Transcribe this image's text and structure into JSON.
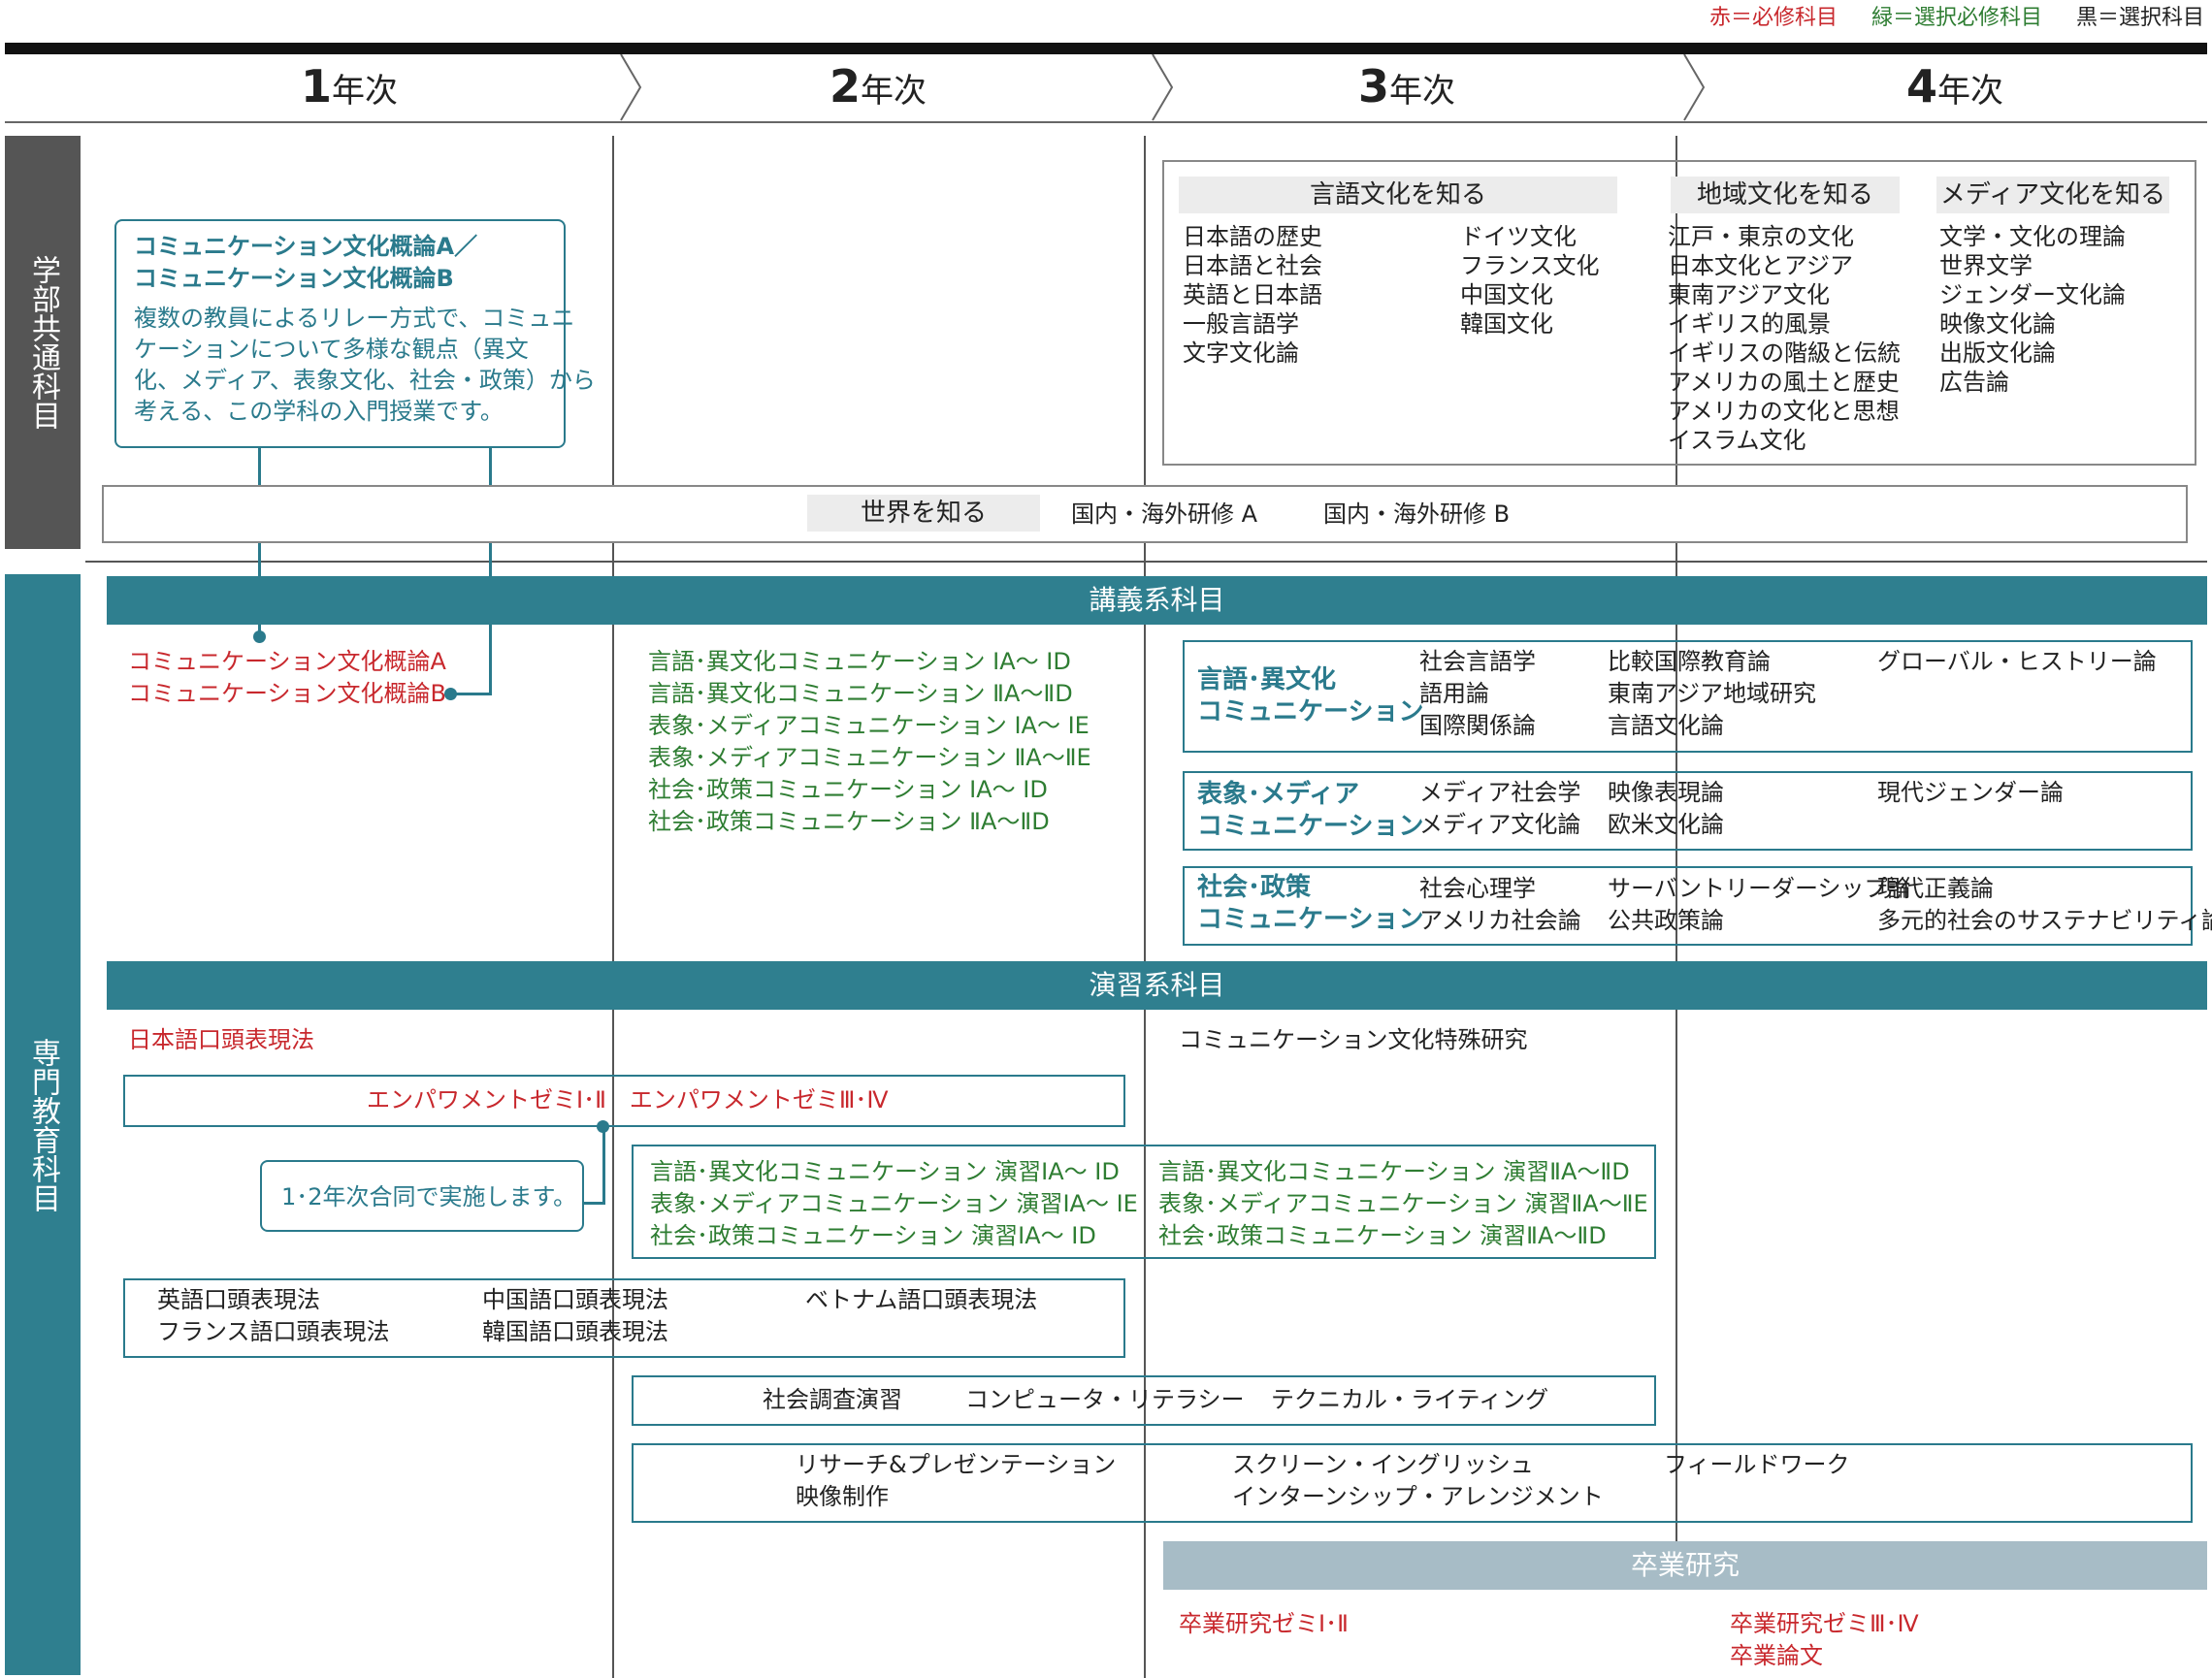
{
  "legend": {
    "red": "赤＝必修科目",
    "green": "緑＝選択必修科目",
    "black": "黒＝選択科目"
  },
  "years": [
    {
      "num": "1",
      "label": "年次"
    },
    {
      "num": "2",
      "label": "年次"
    },
    {
      "num": "3",
      "label": "年次"
    },
    {
      "num": "4",
      "label": "年次"
    }
  ],
  "sidebar": {
    "common": "学部共通科目",
    "specialized": "専門教育科目"
  },
  "intro_box": {
    "title1": "コミュニケーション文化概論A／",
    "title2": "コミュニケーション文化概論B",
    "body": [
      "複数の教員によるリレー方式で、コミュニ",
      "ケーションについて多様な観点（異文",
      "化、メディア、表象文化、社会・政策）から",
      "考える、この学科の入門授業です。"
    ]
  },
  "know_box": {
    "h1": "言語文化を知る",
    "col1": [
      "日本語の歴史",
      "日本語と社会",
      "英語と日本語",
      "一般言語学",
      "文字文化論"
    ],
    "col2": [
      "ドイツ文化",
      "フランス文化",
      "中国文化",
      "韓国文化"
    ],
    "h2": "地域文化を知る",
    "col3": [
      "江戸・東京の文化",
      "日本文化とアジア",
      "東南アジア文化",
      "イギリス的風景",
      "イギリスの階級と伝統",
      "アメリカの風土と歴史",
      "アメリカの文化と思想",
      "イスラム文化"
    ],
    "h3": "メディア文化を知る",
    "col4": [
      "文学・文化の理論",
      "世界文学",
      "ジェンダー文化論",
      "映像文化論",
      "出版文化論",
      "広告論"
    ]
  },
  "world": {
    "title": "世界を知る",
    "a": "国内・海外研修 A",
    "b": "国内・海外研修 B"
  },
  "lecture": {
    "band": "講義系科目",
    "y1": [
      "コミュニケーション文化概論A",
      "コミュニケーション文化概論B"
    ],
    "y2": [
      "言語･異文化コミュニケーション ⅠA～ ⅠD",
      "言語･異文化コミュニケーション ⅡA～ⅡD",
      "表象･メディアコミュニケーション ⅠA～ ⅠE",
      "表象･メディアコミュニケーション ⅡA～ⅡE",
      "社会･政策コミュニケーション ⅠA～ ⅠD",
      "社会･政策コミュニケーション ⅡA～ⅡD"
    ],
    "groups": [
      {
        "title": [
          "言語･異文化",
          "コミュニケーション"
        ],
        "c1": [
          "社会言語学",
          "語用論",
          "国際関係論"
        ],
        "c2": [
          "比較国際教育論",
          "東南アジア地域研究",
          "言語文化論"
        ],
        "c3": [
          "グローバル・ヒストリー論"
        ]
      },
      {
        "title": [
          "表象･メディア",
          "コミュニケーション"
        ],
        "c1": [
          "メディア社会学",
          "メディア文化論"
        ],
        "c2": [
          "映像表現論",
          "欧米文化論"
        ],
        "c3": [
          "現代ジェンダー論"
        ]
      },
      {
        "title": [
          "社会･政策",
          "コミュニケーション"
        ],
        "c1": [
          "社会心理学",
          "アメリカ社会論"
        ],
        "c2": [
          "サーバントリーダーシップ論",
          "公共政策論"
        ],
        "c3": [
          "現代正義論",
          "多元的社会のサステナビリティ論"
        ]
      }
    ]
  },
  "seminar": {
    "band": "演習系科目",
    "nihongo": "日本語口頭表現法",
    "special": "コミュニケーション文化特殊研究",
    "empower": "エンパワメントゼミⅠ･Ⅱ　エンパワメントゼミⅢ･Ⅳ",
    "note": "1･2年次合同で実施します。",
    "ex1": [
      "言語･異文化コミュニケーション 演習ⅠA～ ⅠD",
      "表象･メディアコミュニケーション 演習ⅠA～ ⅠE",
      "社会･政策コミュニケーション 演習ⅠA～ ⅠD"
    ],
    "ex2": [
      "言語･異文化コミュニケーション 演習ⅡA～ⅡD",
      "表象･メディアコミュニケーション 演習ⅡA～ⅡE",
      "社会･政策コミュニケーション 演習ⅡA～ⅡD"
    ],
    "lang": [
      "英語口頭表現法",
      "フランス語口頭表現法",
      "中国語口頭表現法",
      "韓国語口頭表現法",
      "ベトナム語口頭表現法"
    ],
    "skills": [
      "社会調査演習",
      "コンピュータ・リテラシー",
      "テクニカル・ライティング"
    ],
    "research": [
      "リサーチ&プレゼンテーション",
      "映像制作",
      "スクリーン・イングリッシュ",
      "インターンシップ・アレンジメント",
      "フィールドワーク"
    ]
  },
  "graduation": {
    "band": "卒業研究",
    "y3": "卒業研究ゼミⅠ･Ⅱ",
    "y4": [
      "卒業研究ゼミⅢ･Ⅳ",
      "卒業論文"
    ]
  },
  "colors": {
    "teal": "#2f7f8f",
    "gray": "#555555",
    "grad": "#a7bcc6",
    "red": "#c8282d",
    "green": "#2e7d32"
  }
}
